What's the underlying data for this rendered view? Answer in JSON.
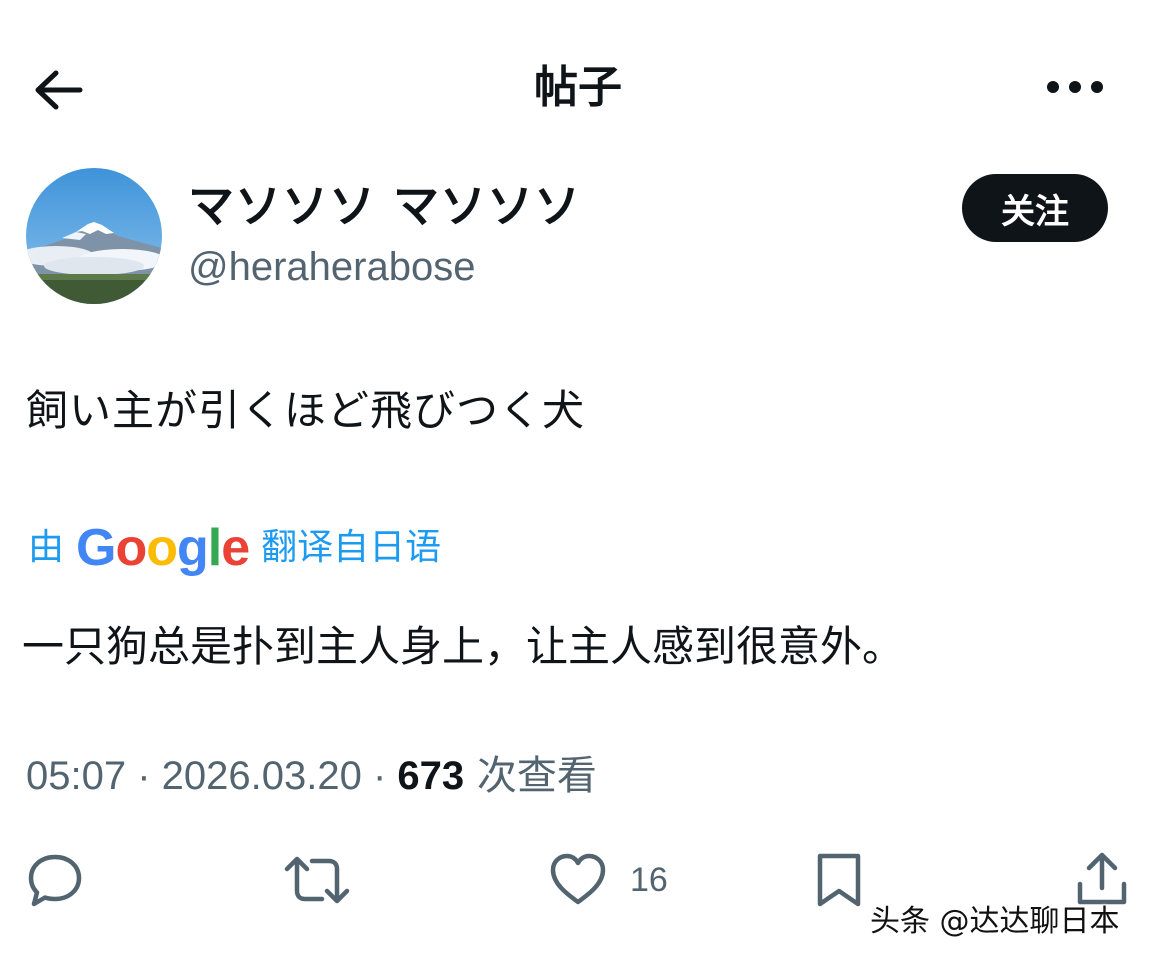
{
  "header": {
    "title": "帖子",
    "back_icon": "arrow-left-icon",
    "more_icon": "more-horizontal-icon"
  },
  "author": {
    "display_name": "マソソソ マソソソ",
    "handle": "@heraherabose",
    "follow_label": "关注",
    "avatar": "mount-fuji-photo"
  },
  "post": {
    "text": "飼い主が引くほど飛びつく犬",
    "translation_prefix": "由",
    "translation_brand": "Google",
    "translation_suffix": "翻译自日语",
    "translated_text": "一只狗总是扑到主人身上，让主人感到很意外。"
  },
  "meta": {
    "time": "05:07",
    "separator": " · ",
    "date": "2026.03.20",
    "views_count": "673",
    "views_label": " 次查看"
  },
  "actions": {
    "reply_icon": "reply-icon",
    "repost_icon": "repost-icon",
    "like_icon": "heart-icon",
    "like_count": "16",
    "bookmark_icon": "bookmark-icon",
    "share_icon": "share-icon"
  },
  "watermark": "头条 @达达聊日本",
  "colors": {
    "text": "#0f1419",
    "secondary": "#536471",
    "link": "#1d9bf0",
    "button_bg": "#0f1419"
  }
}
